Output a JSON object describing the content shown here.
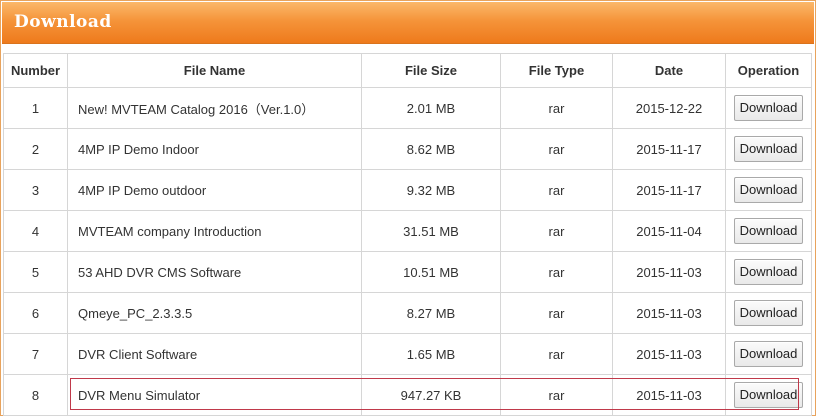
{
  "header": {
    "title": "Download"
  },
  "table": {
    "columns": [
      "Number",
      "File Name",
      "File Size",
      "File Type",
      "Date",
      "Operation"
    ],
    "rows": [
      {
        "number": "1",
        "name": "New! MVTEAM Catalog 2016（Ver.1.0）",
        "size": "2.01 MB",
        "type": "rar",
        "date": "2015-12-22",
        "action": "Download"
      },
      {
        "number": "2",
        "name": "4MP IP Demo Indoor",
        "size": "8.62 MB",
        "type": "rar",
        "date": "2015-11-17",
        "action": "Download"
      },
      {
        "number": "3",
        "name": "4MP IP Demo outdoor",
        "size": "9.32 MB",
        "type": "rar",
        "date": "2015-11-17",
        "action": "Download"
      },
      {
        "number": "4",
        "name": "MVTEAM company Introduction",
        "size": "31.51 MB",
        "type": "rar",
        "date": "2015-11-04",
        "action": "Download"
      },
      {
        "number": "5",
        "name": "53 AHD DVR CMS Software",
        "size": "10.51 MB",
        "type": "rar",
        "date": "2015-11-03",
        "action": "Download"
      },
      {
        "number": "6",
        "name": "Qmeye_PC_2.3.3.5",
        "size": "8.27 MB",
        "type": "rar",
        "date": "2015-11-03",
        "action": "Download"
      },
      {
        "number": "7",
        "name": "DVR Client Software",
        "size": "1.65 MB",
        "type": "rar",
        "date": "2015-11-03",
        "action": "Download"
      },
      {
        "number": "8",
        "name": "DVR Menu Simulator",
        "size": "947.27 KB",
        "type": "rar",
        "date": "2015-11-03",
        "action": "Download"
      }
    ]
  }
}
